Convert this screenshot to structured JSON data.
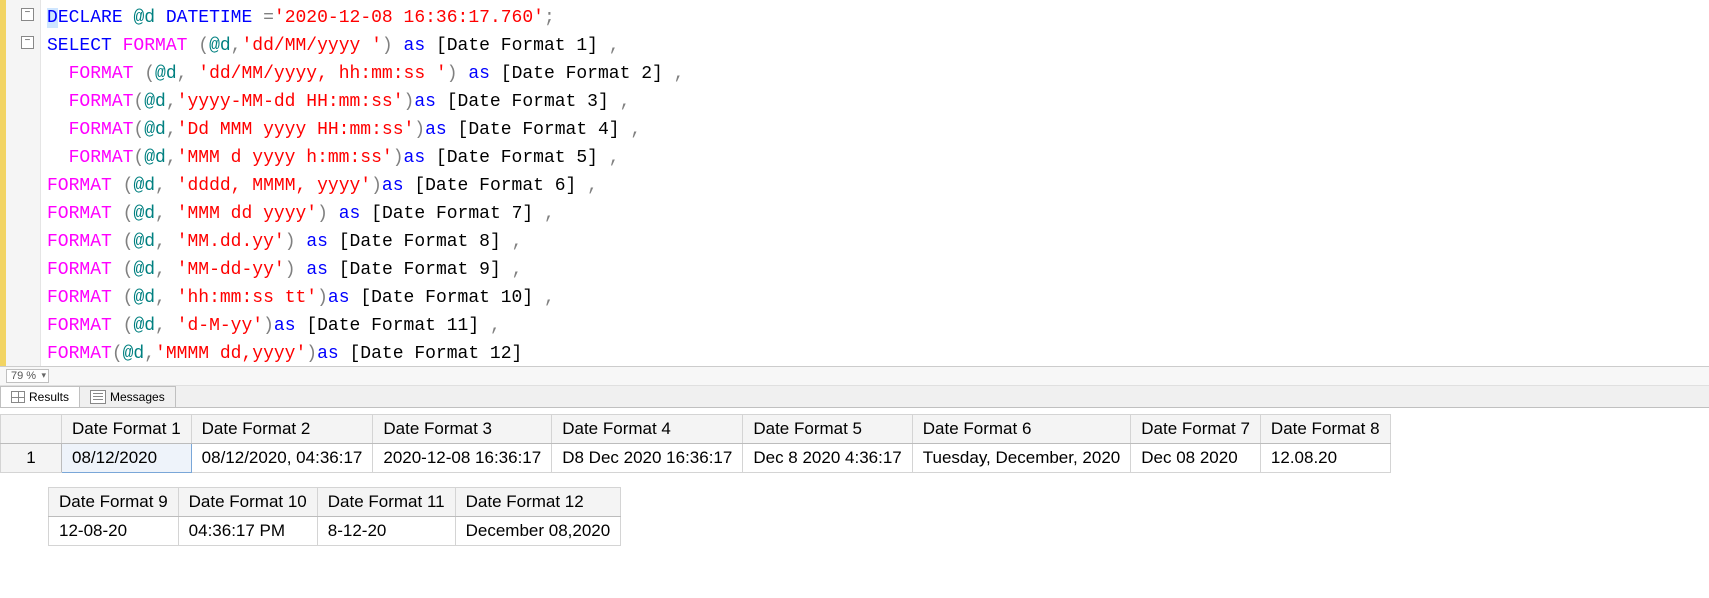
{
  "zoom": {
    "value": "79 %"
  },
  "code": {
    "lines": [
      [
        {
          "cls": "kw hl",
          "t": "D"
        },
        {
          "cls": "kw",
          "t": "ECLARE"
        },
        {
          "cls": "",
          "t": " "
        },
        {
          "cls": "lv",
          "t": "@d"
        },
        {
          "cls": "",
          "t": " "
        },
        {
          "cls": "kw",
          "t": "DATETIME"
        },
        {
          "cls": "",
          "t": " "
        },
        {
          "cls": "gr",
          "t": "="
        },
        {
          "cls": "str",
          "t": "'2020-12-08 16:36:17.760'"
        },
        {
          "cls": "gr",
          "t": ";"
        }
      ],
      [
        {
          "cls": "kw",
          "t": "SELECT"
        },
        {
          "cls": "",
          "t": " "
        },
        {
          "cls": "fn",
          "t": "FORMAT"
        },
        {
          "cls": "",
          "t": " "
        },
        {
          "cls": "gr",
          "t": "("
        },
        {
          "cls": "lv",
          "t": "@d"
        },
        {
          "cls": "gr",
          "t": ","
        },
        {
          "cls": "str",
          "t": "'dd/MM/yyyy '"
        },
        {
          "cls": "gr",
          "t": ")"
        },
        {
          "cls": "",
          "t": " "
        },
        {
          "cls": "kw",
          "t": "as"
        },
        {
          "cls": "",
          "t": " [Date Format 1] "
        },
        {
          "cls": "gr",
          "t": ","
        }
      ],
      [
        {
          "cls": "",
          "t": "  "
        },
        {
          "cls": "fn",
          "t": "FORMAT"
        },
        {
          "cls": "",
          "t": " "
        },
        {
          "cls": "gr",
          "t": "("
        },
        {
          "cls": "lv",
          "t": "@d"
        },
        {
          "cls": "gr",
          "t": ","
        },
        {
          "cls": "",
          "t": " "
        },
        {
          "cls": "str",
          "t": "'dd/MM/yyyy, hh:mm:ss '"
        },
        {
          "cls": "gr",
          "t": ")"
        },
        {
          "cls": "",
          "t": " "
        },
        {
          "cls": "kw",
          "t": "as"
        },
        {
          "cls": "",
          "t": " [Date Format 2] "
        },
        {
          "cls": "gr",
          "t": ","
        }
      ],
      [
        {
          "cls": "",
          "t": "  "
        },
        {
          "cls": "fn",
          "t": "FORMAT"
        },
        {
          "cls": "gr",
          "t": "("
        },
        {
          "cls": "lv",
          "t": "@d"
        },
        {
          "cls": "gr",
          "t": ","
        },
        {
          "cls": "str",
          "t": "'yyyy-MM-dd HH:mm:ss'"
        },
        {
          "cls": "gr",
          "t": ")"
        },
        {
          "cls": "kw",
          "t": "as"
        },
        {
          "cls": "",
          "t": " [Date Format 3] "
        },
        {
          "cls": "gr",
          "t": ","
        }
      ],
      [
        {
          "cls": "",
          "t": "  "
        },
        {
          "cls": "fn",
          "t": "FORMAT"
        },
        {
          "cls": "gr",
          "t": "("
        },
        {
          "cls": "lv",
          "t": "@d"
        },
        {
          "cls": "gr",
          "t": ","
        },
        {
          "cls": "str",
          "t": "'Dd MMM yyyy HH:mm:ss'"
        },
        {
          "cls": "gr",
          "t": ")"
        },
        {
          "cls": "kw",
          "t": "as"
        },
        {
          "cls": "",
          "t": " [Date Format 4] "
        },
        {
          "cls": "gr",
          "t": ","
        }
      ],
      [
        {
          "cls": "",
          "t": "  "
        },
        {
          "cls": "fn",
          "t": "FORMAT"
        },
        {
          "cls": "gr",
          "t": "("
        },
        {
          "cls": "lv",
          "t": "@d"
        },
        {
          "cls": "gr",
          "t": ","
        },
        {
          "cls": "str",
          "t": "'MMM d yyyy h:mm:ss'"
        },
        {
          "cls": "gr",
          "t": ")"
        },
        {
          "cls": "kw",
          "t": "as"
        },
        {
          "cls": "",
          "t": " [Date Format 5] "
        },
        {
          "cls": "gr",
          "t": ","
        }
      ],
      [
        {
          "cls": "fn",
          "t": "FORMAT"
        },
        {
          "cls": "",
          "t": " "
        },
        {
          "cls": "gr",
          "t": "("
        },
        {
          "cls": "lv",
          "t": "@d"
        },
        {
          "cls": "gr",
          "t": ","
        },
        {
          "cls": "",
          "t": " "
        },
        {
          "cls": "str",
          "t": "'dddd, MMMM, yyyy'"
        },
        {
          "cls": "gr",
          "t": ")"
        },
        {
          "cls": "kw",
          "t": "as"
        },
        {
          "cls": "",
          "t": " [Date Format 6] "
        },
        {
          "cls": "gr",
          "t": ","
        }
      ],
      [
        {
          "cls": "fn",
          "t": "FORMAT"
        },
        {
          "cls": "",
          "t": " "
        },
        {
          "cls": "gr",
          "t": "("
        },
        {
          "cls": "lv",
          "t": "@d"
        },
        {
          "cls": "gr",
          "t": ","
        },
        {
          "cls": "",
          "t": " "
        },
        {
          "cls": "str",
          "t": "'MMM dd yyyy'"
        },
        {
          "cls": "gr",
          "t": ")"
        },
        {
          "cls": "",
          "t": " "
        },
        {
          "cls": "kw",
          "t": "as"
        },
        {
          "cls": "",
          "t": " [Date Format 7] "
        },
        {
          "cls": "gr",
          "t": ","
        }
      ],
      [
        {
          "cls": "fn",
          "t": "FORMAT"
        },
        {
          "cls": "",
          "t": " "
        },
        {
          "cls": "gr",
          "t": "("
        },
        {
          "cls": "lv",
          "t": "@d"
        },
        {
          "cls": "gr",
          "t": ","
        },
        {
          "cls": "",
          "t": " "
        },
        {
          "cls": "str",
          "t": "'MM.dd.yy'"
        },
        {
          "cls": "gr",
          "t": ")"
        },
        {
          "cls": "",
          "t": " "
        },
        {
          "cls": "kw",
          "t": "as"
        },
        {
          "cls": "",
          "t": " [Date Format 8] "
        },
        {
          "cls": "gr",
          "t": ","
        }
      ],
      [
        {
          "cls": "fn",
          "t": "FORMAT"
        },
        {
          "cls": "",
          "t": " "
        },
        {
          "cls": "gr",
          "t": "("
        },
        {
          "cls": "lv",
          "t": "@d"
        },
        {
          "cls": "gr",
          "t": ","
        },
        {
          "cls": "",
          "t": " "
        },
        {
          "cls": "str",
          "t": "'MM-dd-yy'"
        },
        {
          "cls": "gr",
          "t": ")"
        },
        {
          "cls": "",
          "t": " "
        },
        {
          "cls": "kw",
          "t": "as"
        },
        {
          "cls": "",
          "t": " [Date Format 9] "
        },
        {
          "cls": "gr",
          "t": ","
        }
      ],
      [
        {
          "cls": "fn",
          "t": "FORMAT"
        },
        {
          "cls": "",
          "t": " "
        },
        {
          "cls": "gr",
          "t": "("
        },
        {
          "cls": "lv",
          "t": "@d"
        },
        {
          "cls": "gr",
          "t": ","
        },
        {
          "cls": "",
          "t": " "
        },
        {
          "cls": "str",
          "t": "'hh:mm:ss tt'"
        },
        {
          "cls": "gr",
          "t": ")"
        },
        {
          "cls": "kw",
          "t": "as"
        },
        {
          "cls": "",
          "t": " [Date Format 10] "
        },
        {
          "cls": "gr",
          "t": ","
        }
      ],
      [
        {
          "cls": "fn",
          "t": "FORMAT"
        },
        {
          "cls": "",
          "t": " "
        },
        {
          "cls": "gr",
          "t": "("
        },
        {
          "cls": "lv",
          "t": "@d"
        },
        {
          "cls": "gr",
          "t": ","
        },
        {
          "cls": "",
          "t": " "
        },
        {
          "cls": "str",
          "t": "'d-M-yy'"
        },
        {
          "cls": "gr",
          "t": ")"
        },
        {
          "cls": "kw",
          "t": "as"
        },
        {
          "cls": "",
          "t": " [Date Format 11] "
        },
        {
          "cls": "gr",
          "t": ","
        }
      ],
      [
        {
          "cls": "fn",
          "t": "FORMAT"
        },
        {
          "cls": "gr",
          "t": "("
        },
        {
          "cls": "lv",
          "t": "@d"
        },
        {
          "cls": "gr",
          "t": ","
        },
        {
          "cls": "str",
          "t": "'MMMM dd,yyyy'"
        },
        {
          "cls": "gr",
          "t": ")"
        },
        {
          "cls": "kw",
          "t": "as"
        },
        {
          "cls": "",
          "t": " [Date Format 12]"
        }
      ]
    ]
  },
  "tabs": {
    "results": "Results",
    "messages": "Messages"
  },
  "grid1": {
    "rownum": "1",
    "headers": [
      "Date Format 1",
      "Date Format 2",
      "Date Format 3",
      "Date Format 4",
      "Date Format 5",
      "Date Format 6",
      "Date Format 7",
      "Date Format 8"
    ],
    "row": [
      "08/12/2020",
      "08/12/2020, 04:36:17",
      "2020-12-08 16:36:17",
      "D8 Dec 2020 16:36:17",
      "Dec 8 2020 4:36:17",
      "Tuesday, December, 2020",
      "Dec 08 2020",
      "12.08.20"
    ]
  },
  "grid2": {
    "headers": [
      "Date Format 9",
      "Date Format 10",
      "Date Format 11",
      "Date Format 12"
    ],
    "row": [
      "12-08-20",
      "04:36:17 PM",
      "8-12-20",
      "December 08,2020"
    ]
  }
}
